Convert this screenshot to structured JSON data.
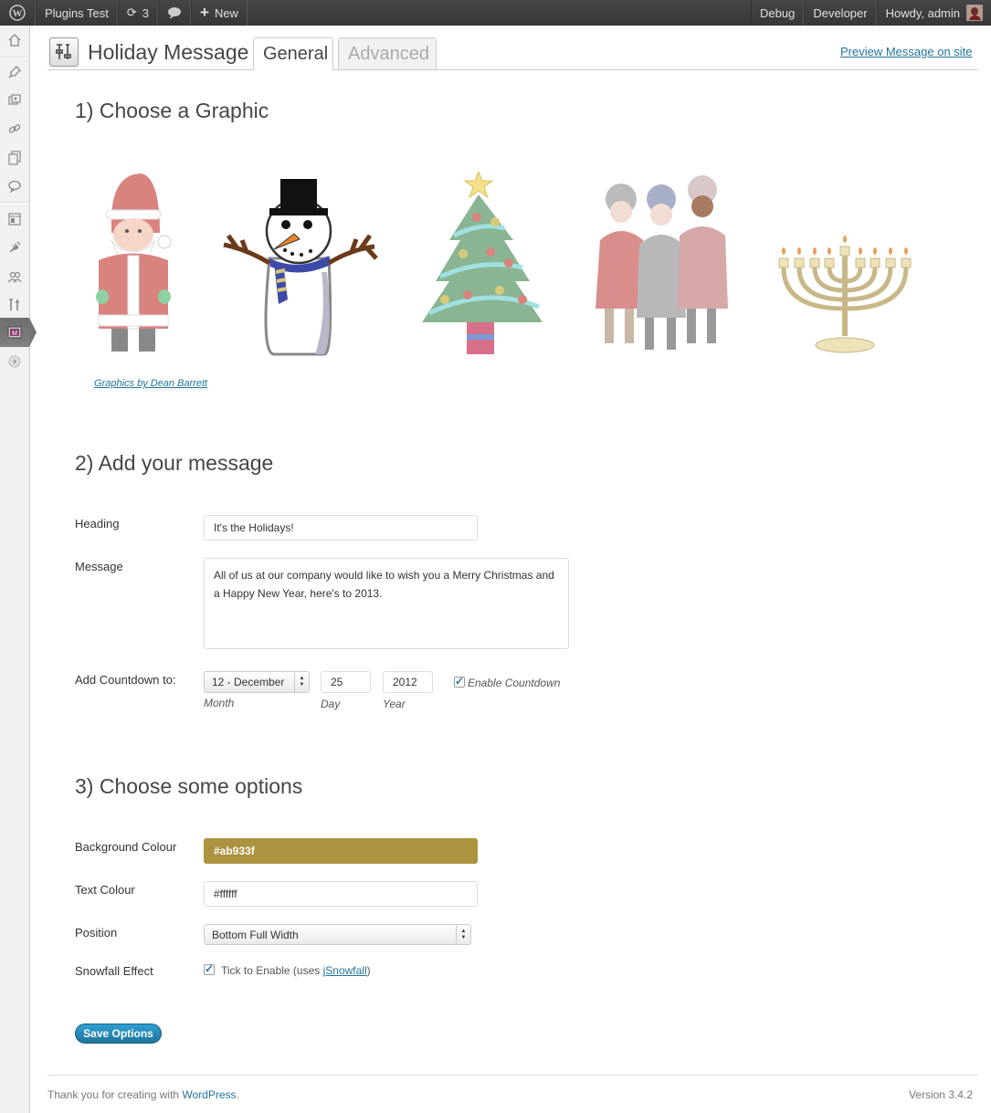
{
  "adminbar": {
    "site_name": "Plugins Test",
    "updates_count": "3",
    "new_label": "New",
    "debug_label": "Debug",
    "developer_label": "Developer",
    "howdy_label": "Howdy, admin"
  },
  "header": {
    "title": "Holiday Message",
    "tabs": [
      {
        "label": "General",
        "active": true
      },
      {
        "label": "Advanced",
        "active": false
      }
    ],
    "preview_link": "Preview Message on site"
  },
  "section1": {
    "heading": "1) Choose a Graphic",
    "graphics": [
      {
        "name": "santa"
      },
      {
        "name": "snowman"
      },
      {
        "name": "christmas-tree"
      },
      {
        "name": "carolers"
      },
      {
        "name": "menorah"
      }
    ],
    "credit": "Graphics by Dean Barrett"
  },
  "section2": {
    "heading": "2) Add your message",
    "heading_label": "Heading",
    "heading_value": "It's the Holidays!",
    "message_label": "Message",
    "message_value": "All of us at our company would like to wish you a Merry Christmas and a Happy New Year, here's to 2013.",
    "countdown_label": "Add Countdown to:",
    "month_value": "12 - December",
    "day_value": "25",
    "year_value": "2012",
    "month_sublabel": "Month",
    "day_sublabel": "Day",
    "year_sublabel": "Year",
    "enable_countdown_label": "Enable Countdown",
    "enable_countdown_checked": true
  },
  "section3": {
    "heading": "3) Choose some options",
    "bg_colour_label": "Background Colour",
    "bg_colour_value": "#ab933f",
    "text_colour_label": "Text Colour",
    "text_colour_value": "#ffffff",
    "position_label": "Position",
    "position_value": "Bottom Full Width",
    "snowfall_label": "Snowfall Effect",
    "snowfall_text": "Tick to Enable (uses ",
    "snowfall_link": "jSnowfall",
    "snowfall_suffix": ")",
    "snowfall_checked": true
  },
  "save_label": "Save Options",
  "footer": {
    "thanks_text": "Thank you for creating with ",
    "wordpress_link": "WordPress",
    "period": ".",
    "version": "Version 3.4.2"
  },
  "menu_icons": [
    "dashboard-icon",
    "posts-icon",
    "media-icon",
    "links-icon",
    "pages-icon",
    "comments-icon",
    "appearance-icon",
    "plugins-icon",
    "users-icon",
    "tools-icon",
    "holiday-plugin-icon",
    "collapse-icon"
  ],
  "colors": {
    "accent": "#21759b",
    "bg_swatch": "#ab933f"
  }
}
